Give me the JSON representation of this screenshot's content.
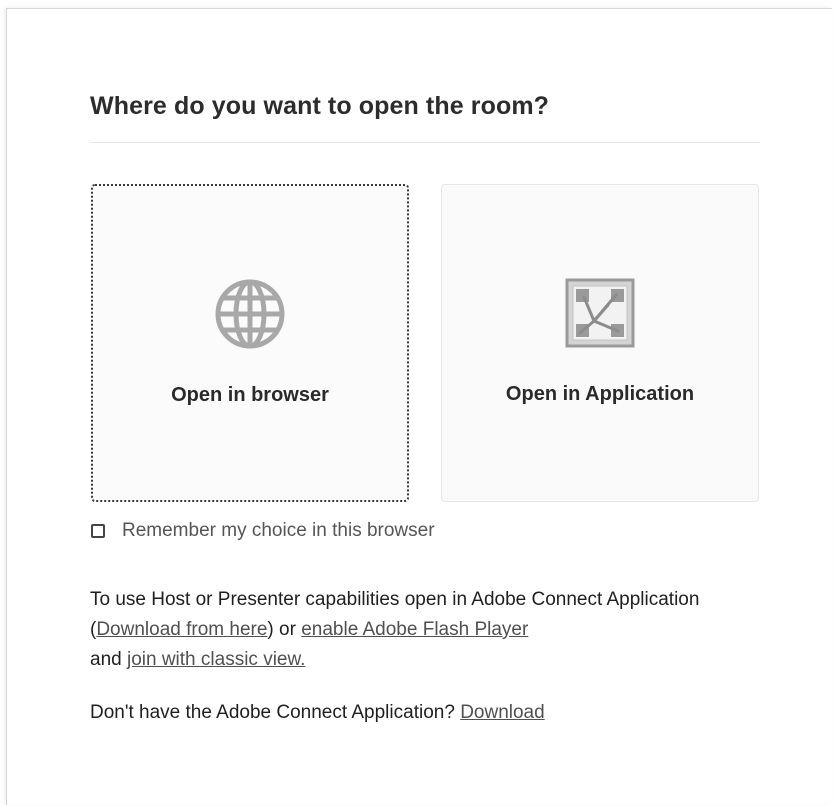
{
  "dialog": {
    "title": "Where do you want to open the room?"
  },
  "options": {
    "browser": {
      "label": "Open in browser",
      "icon": "globe-icon"
    },
    "application": {
      "label": "Open in Application",
      "icon": "adobe-connect-app-icon"
    }
  },
  "remember": {
    "label": "Remember my choice in this browser",
    "checked": false
  },
  "info": {
    "text_1": "To use Host or Presenter capabilities open in Adobe Connect Application (",
    "download_link": "Download from here",
    "text_2": ") or ",
    "flash_link": "enable Adobe Flash Player",
    "text_3": "and ",
    "classic_link": "join with classic view."
  },
  "download_prompt": {
    "text": "Don't have the Adobe Connect Application? ",
    "link": "Download"
  },
  "colors": {
    "icon_gray": "#a8a8a8",
    "card_bg": "#fafafa",
    "link": "#505050"
  }
}
